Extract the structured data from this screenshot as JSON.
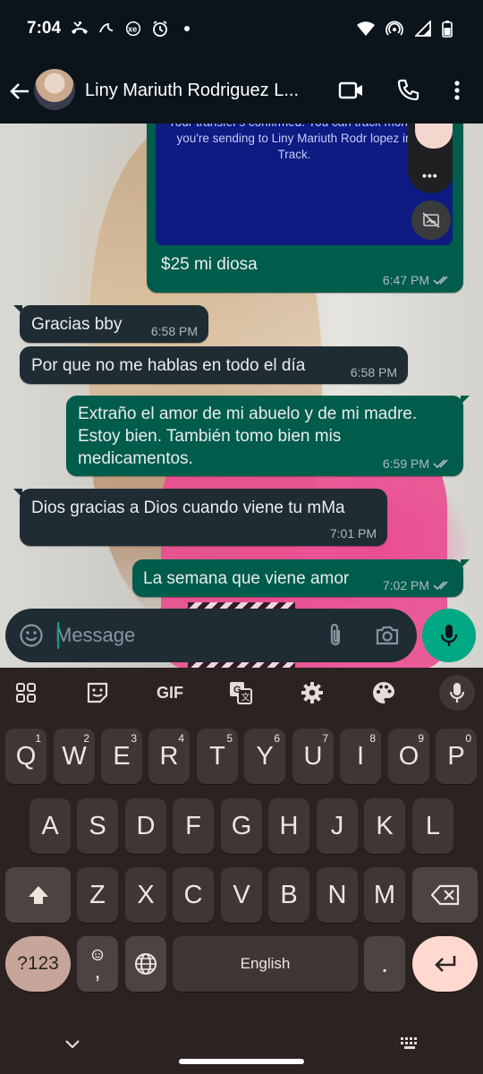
{
  "status_bar": {
    "time": "7:04",
    "left_icons": [
      "missed-call-icon",
      "tiktok-icon",
      "xe-icon",
      "alarm-icon",
      "notification-dot-icon"
    ],
    "right_icons": [
      "wifi-icon",
      "hotspot-icon",
      "signal-icon",
      "battery-icon"
    ]
  },
  "header": {
    "contact_name": "Liny Mariuth Rodriguez L...",
    "actions": [
      "video-call",
      "voice-call",
      "more-options"
    ]
  },
  "transfer_card": {
    "text": "Your transfer's confirmed. You can track money you're sending to Liny Mariuth Rodr lopez in Track.",
    "dots": "•••"
  },
  "messages": [
    {
      "direction": "out",
      "text": "$25 mi diosa",
      "time": "6:47 PM",
      "read": true
    },
    {
      "direction": "in",
      "text": "Gracias bby",
      "time": "6:58 PM"
    },
    {
      "direction": "in",
      "text": "Por que no me hablas en todo el día",
      "time": "6:58 PM"
    },
    {
      "direction": "out",
      "text": "Extraño el amor de mi abuelo y de mi madre. Estoy bien. También tomo bien mis medicamentos.",
      "time": "6:59 PM",
      "read": true
    },
    {
      "direction": "in",
      "text": "Dios gracias a Dios cuando viene tu mMa",
      "time": "7:01 PM"
    },
    {
      "direction": "out",
      "text": "La semana que viene amor",
      "time": "7:02 PM",
      "read": true
    }
  ],
  "composer": {
    "placeholder": "Message"
  },
  "keyboard": {
    "toolbar": {
      "gif_label": "GIF"
    },
    "row1": [
      {
        "key": "Q",
        "hint": "1"
      },
      {
        "key": "W",
        "hint": "2"
      },
      {
        "key": "E",
        "hint": "3"
      },
      {
        "key": "R",
        "hint": "4"
      },
      {
        "key": "T",
        "hint": "5"
      },
      {
        "key": "Y",
        "hint": "6"
      },
      {
        "key": "U",
        "hint": "7"
      },
      {
        "key": "I",
        "hint": "8"
      },
      {
        "key": "O",
        "hint": "9"
      },
      {
        "key": "P",
        "hint": "0"
      }
    ],
    "row2": [
      "A",
      "S",
      "D",
      "F",
      "G",
      "H",
      "J",
      "K",
      "L"
    ],
    "row3": [
      "Z",
      "X",
      "C",
      "V",
      "B",
      "N",
      "M"
    ],
    "symbols_label": "?123",
    "comma_label": ",",
    "space_label": "English",
    "period_label": "."
  },
  "colors": {
    "header_bg": "#0b141a",
    "incoming_bubble": "#202c33",
    "outgoing_bubble": "#005c4b",
    "accent_green": "#00a884",
    "keyboard_bg": "#2b2321",
    "key_bg": "#3f3735",
    "enter_key": "#ffd9cf"
  }
}
